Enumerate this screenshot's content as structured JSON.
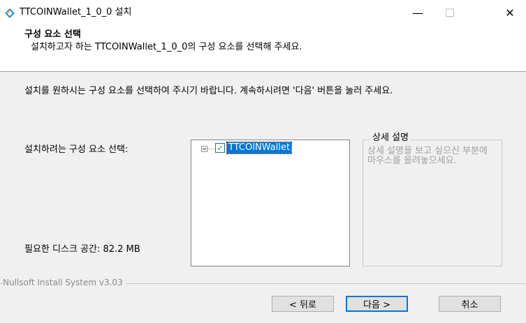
{
  "window": {
    "title": "TTCOINWallet_1_0_0 설치",
    "minimize_glyph": "—",
    "maximize_glyph": "☐",
    "close_glyph": "✕"
  },
  "header": {
    "title": "구성 요소 선택",
    "subtitle": "설치하고자 하는 TTCOINWallet_1_0_0의 구성 요소를 선택해 주세요."
  },
  "body": {
    "instructions": "설치를 원하시는 구성 요소를 선택하여 주시기 바랍니다. 계속하시려면 '다음' 버튼을 눌러 주세요.",
    "select_label": "설치하려는 구성 요소 선택:",
    "disk_space_label": "필요한 디스크 공간: 82.2 MB",
    "tree": {
      "items": [
        {
          "label": "TTCOINWallet",
          "checked": true,
          "check_glyph": "✓"
        }
      ]
    },
    "description": {
      "title": "상세 설명",
      "text": "상세 설명을 보고 싶으신 부분에 마우스를 올려놓으세요."
    }
  },
  "footer": {
    "branding": "Nullsoft Install System v3.03",
    "buttons": {
      "back": "< 뒤로",
      "next": "다음 >",
      "cancel": "취소"
    }
  },
  "colors": {
    "accent": "#0078d7",
    "window_bg": "#f0f0f0",
    "check": "#2aa640"
  },
  "icons": {
    "app": "installer-app-icon"
  }
}
